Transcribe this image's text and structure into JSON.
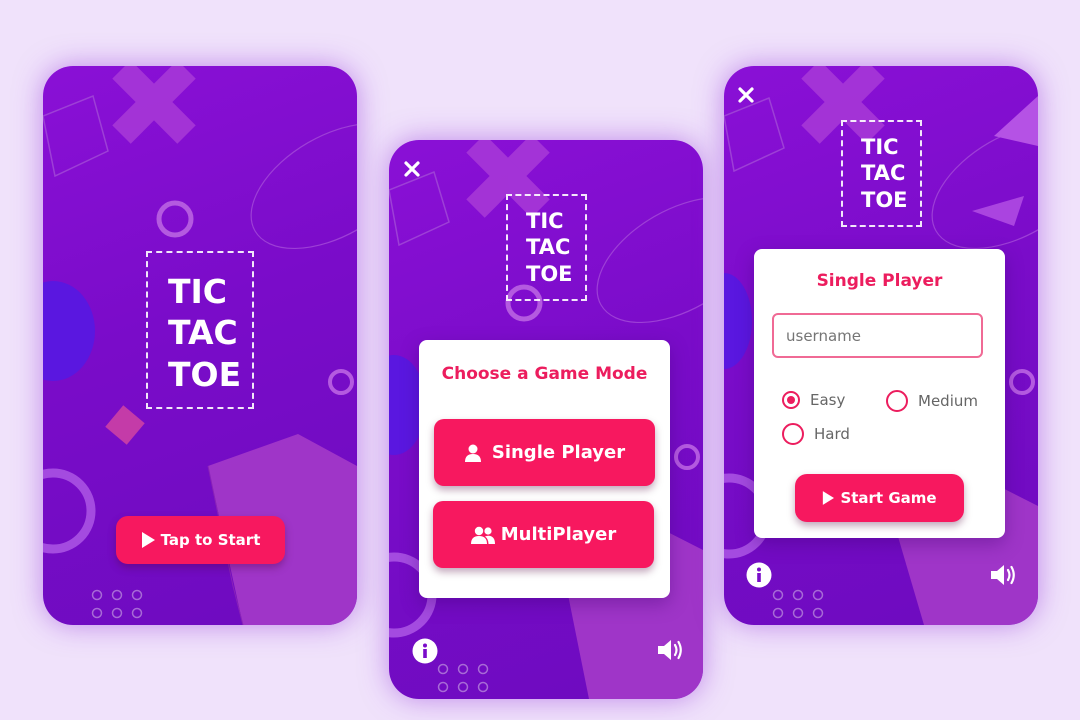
{
  "logo_lines": [
    "TIC",
    "TAC",
    "TOE"
  ],
  "screen1": {
    "start_button": "Tap to Start"
  },
  "screen2": {
    "title": "Choose a Game Mode",
    "single_button": "Single Player",
    "multi_button": "MultiPlayer"
  },
  "screen3": {
    "title": "Single Player",
    "username_placeholder": "username",
    "difficulty": [
      {
        "label": "Easy",
        "selected": true
      },
      {
        "label": "Medium",
        "selected": false
      },
      {
        "label": "Hard",
        "selected": false
      }
    ],
    "start_button": "Start Game"
  },
  "icons": {
    "close": "close-icon",
    "info": "info-icon",
    "sound": "speaker-icon",
    "play": "play-icon",
    "user": "user-icon",
    "users": "users-icon"
  },
  "colors": {
    "accent": "#f7185f",
    "title_pink": "#ec1d5e",
    "phone_purple": "#7a0cc9",
    "page_bg": "#f0e2fb"
  }
}
